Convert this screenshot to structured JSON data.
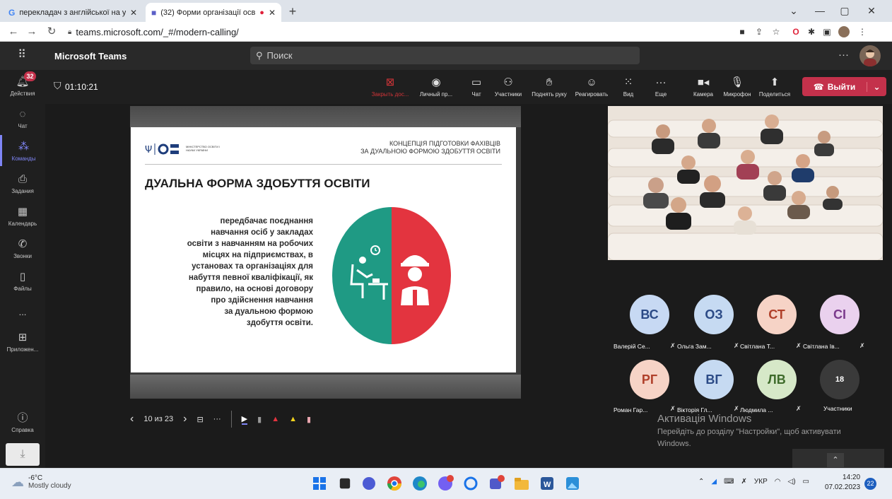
{
  "browser": {
    "tabs": [
      {
        "label": "перекладач з англійської на укр",
        "icon": "google-icon"
      },
      {
        "label": "(32) Форми організації осві",
        "icon": "teams-icon"
      }
    ],
    "url": "teams.microsoft.com/_#/modern-calling/"
  },
  "teams": {
    "brand": "Microsoft Teams",
    "search_placeholder": "Поиск"
  },
  "rail": {
    "badge": "32",
    "items": [
      {
        "label": "Действия"
      },
      {
        "label": "Чат"
      },
      {
        "label": "Команды"
      },
      {
        "label": "Задания"
      },
      {
        "label": "Календарь"
      },
      {
        "label": "Звонки"
      },
      {
        "label": "Файлы"
      },
      {
        "label": "..."
      },
      {
        "label": "Приложен..."
      },
      {
        "label": "Справка"
      }
    ]
  },
  "meeting": {
    "timer": "01:10:21",
    "controls": [
      {
        "label": "Закрыть дос...",
        "icon": "close-share-icon"
      },
      {
        "label": "Личный пр...",
        "icon": "eye-icon"
      },
      {
        "label": "Чат",
        "icon": "chat-icon"
      },
      {
        "label": "Участники",
        "icon": "people-icon"
      },
      {
        "label": "Поднять руку",
        "icon": "raise-hand-icon"
      },
      {
        "label": "Реагировать",
        "icon": "smile-icon"
      },
      {
        "label": "Вид",
        "icon": "grid-icon"
      },
      {
        "label": "Еще",
        "icon": "more-icon"
      },
      {
        "label": "Камера",
        "icon": "camera-icon"
      },
      {
        "label": "Микрофон",
        "icon": "mic-icon"
      },
      {
        "label": "Поделиться",
        "icon": "share-icon"
      }
    ],
    "leave_label": "Выйти"
  },
  "slide": {
    "header_right_line1": "КОНЦЕПЦІЯ ПІДГОТОВКИ ФАХІВЦІВ",
    "header_right_line2": "ЗА ДУАЛЬНОЮ ФОРМОЮ ЗДОБУТТЯ ОСВІТИ",
    "logo_text": "МІНІСТЕРСТВО ОСВІТИ І НАУКИ УКРАЇНИ",
    "title": "ДУАЛЬНА ФОРМА ЗДОБУТТЯ ОСВІТИ",
    "body_lines": [
      "передбачає поєднання",
      "навчання осіб у закладах",
      "освіти з навчанням на робочих",
      "місцях на підприємствах, в",
      "установах та організаціях для",
      "набуття певної кваліфікації, як",
      "правило, на основі договору",
      "про здійснення навчання",
      "за дуальною формою",
      "здобуття освіти."
    ],
    "page_indicator": "10 из 23",
    "colors": {
      "green": "#1f9a84",
      "red": "#e3343f"
    }
  },
  "participants": [
    {
      "initials": "ВС",
      "name": "Валерій Се...",
      "bg": "#c7d9f3",
      "fg": "#2b4a86"
    },
    {
      "initials": "ОЗ",
      "name": "Ольга Зам...",
      "bg": "#c6daf2",
      "fg": "#2b4a86"
    },
    {
      "initials": "СТ",
      "name": "Світлана Т...",
      "bg": "#f6d3c6",
      "fg": "#b0402a"
    },
    {
      "initials": "СІ",
      "name": "Світлана Ів...",
      "bg": "#ead1ee",
      "fg": "#7b3a8c"
    },
    {
      "initials": "РГ",
      "name": "Роман Гар...",
      "bg": "#f6d3c6",
      "fg": "#b0402a"
    },
    {
      "initials": "ВГ",
      "name": "Вікторія Гл...",
      "bg": "#c6daf2",
      "fg": "#2b4a86"
    },
    {
      "initials": "ЛВ",
      "name": "Людмила ...",
      "bg": "#d6e8c8",
      "fg": "#3e6b2b"
    },
    {
      "initials": "18",
      "name": "Участники",
      "bg": "#3a3a3a",
      "fg": "#ffffff"
    }
  ],
  "watermark": {
    "title": "Активація Windows",
    "desc": "Перейдіть до розділу \"Настройки\", щоб активувати Windows."
  },
  "taskbar": {
    "temp": "-6°C",
    "weather": "Mostly cloudy",
    "lang": "УКР",
    "time": "14:20",
    "date": "07.02.2023",
    "notif_count": "22"
  }
}
